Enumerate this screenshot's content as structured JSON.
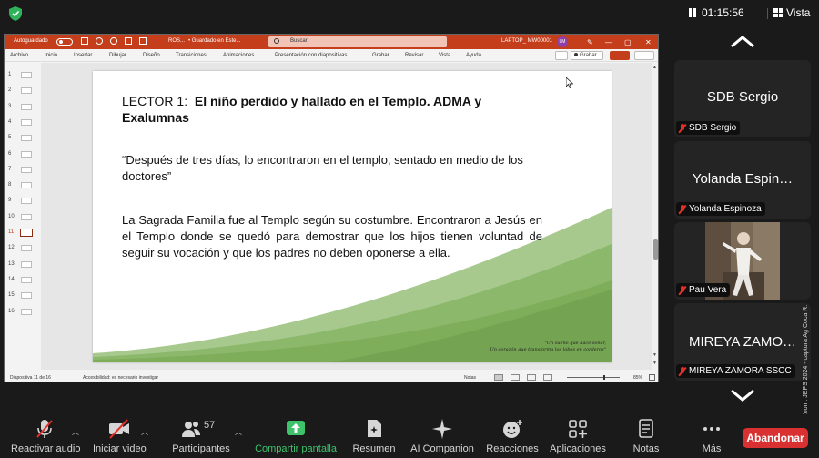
{
  "zoom_top": {
    "timer": "01:15:56",
    "view_label": "Vista"
  },
  "ppt": {
    "autosave_label": "Autoguardado",
    "file_name": "ROS...",
    "saved_status": "• Guardado en Este...",
    "search_placeholder": "Buscar",
    "device_name": "LAPTOP_ MW00001",
    "user_initials": "LM",
    "ribbon_tabs": [
      "Archivo",
      "Inicio",
      "Insertar",
      "Dibujar",
      "Diseño",
      "Transiciones",
      "Animaciones",
      "Presentación con diapositivas",
      "Grabar",
      "Revisar",
      "Vista",
      "Ayuda"
    ],
    "record_button": "Grabar",
    "slide_numbers": [
      "1",
      "2",
      "3",
      "4",
      "5",
      "6",
      "7",
      "8",
      "9",
      "10",
      "11",
      "12",
      "13",
      "14",
      "15",
      "16"
    ],
    "selected_slide": 11,
    "slide": {
      "title_prefix": "LECTOR 1:",
      "title_bold": "El niño perdido y hallado en el Templo. ADMA y Exalumnas",
      "quote": "“Después de tres días, lo encontraron en el templo, sentado en medio de los doctores”",
      "body": "La Sagrada Familia fue al Templo según su costumbre. Encontraron a Jesús en el Templo donde se quedó para demostrar que los hijos tienen voluntad de seguir su vocación y que los padres no deben oponerse a ella.",
      "motto_line1": "\"Un sueño que hace soñar,",
      "motto_line2": "Un corazón que transforma los lobos en corderos\""
    },
    "status": {
      "slide_counter": "Diapositiva 11 de 16",
      "accessibility": "Accesibilidad: es necesario investigar",
      "notes": "Notas",
      "zoom": "85%"
    }
  },
  "participants": [
    {
      "big_name": "SDB Sergio",
      "label": "SDB Sergio",
      "has_video": false
    },
    {
      "big_name": "Yolanda Espin…",
      "label": "Yolanda Espinoza",
      "has_video": false
    },
    {
      "big_name": "",
      "label": "Pau Vera",
      "has_video": true
    },
    {
      "big_name": "MIREYA ZAMO…",
      "label": "MIREYA ZAMORA SSCC",
      "has_video": false
    }
  ],
  "watermark": "Cortesía © Zoom. JEPS 2024 - captura Ag Coca R.",
  "toolbar": {
    "audio": "Reactivar audio",
    "video": "Iniciar video",
    "participants": "Participantes",
    "participant_count": "57",
    "share": "Compartir pantalla",
    "summary": "Resumen",
    "companion": "AI Companion",
    "reactions": "Reacciones",
    "apps": "Aplicaciones",
    "notes": "Notas",
    "more": "Más",
    "leave": "Abandonar"
  },
  "colors": {
    "ppt_accent": "#c43e1c",
    "zoom_share_green": "#3ec26b",
    "leave_red": "#d93131",
    "slide_wave_green": "#7fae5b"
  }
}
